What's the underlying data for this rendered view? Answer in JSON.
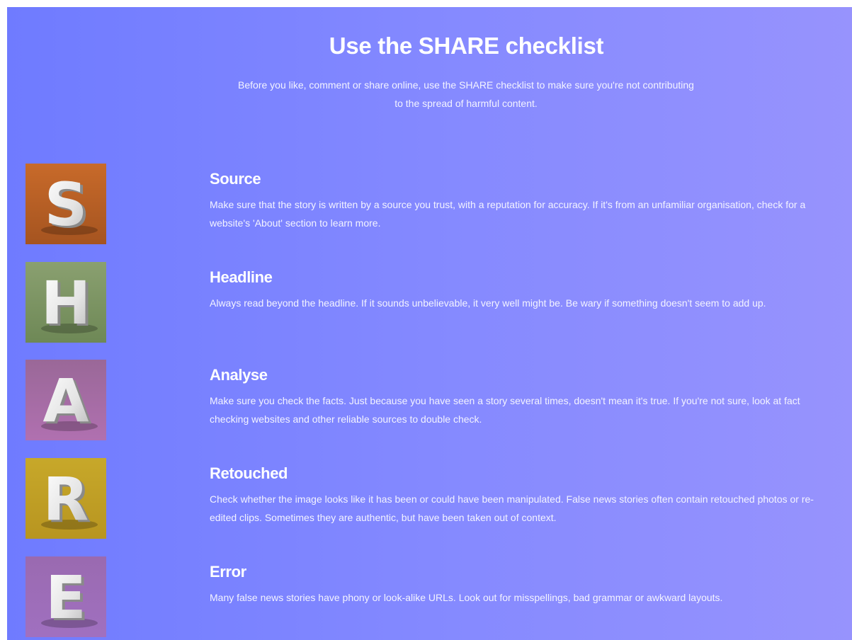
{
  "header": {
    "title": "Use the SHARE checklist",
    "intro_line1": "Before you like, comment or share online, use the SHARE checklist to make sure you're not contributing",
    "intro_line2": "to the spread of harmful content."
  },
  "colors": {
    "gradient_start": "#6f7bff",
    "gradient_end": "#9793fd",
    "text": "#ffffff"
  },
  "items": [
    {
      "letter": "S",
      "tile_color_top": "#c86a2a",
      "tile_color_bottom": "#a55420",
      "title": "Source",
      "description": "Make sure that the story is written by a source you trust, with a reputation for accuracy. If it's from an unfamiliar organisation, check for a website's 'About' section to learn more."
    },
    {
      "letter": "H",
      "tile_color_top": "#8aa070",
      "tile_color_bottom": "#6e8856",
      "title": "Headline",
      "description": "Always read beyond the headline. If it sounds unbelievable, it very well might be. Be wary if something doesn't seem to add up."
    },
    {
      "letter": "A",
      "tile_color_top": "#9a6898",
      "tile_color_bottom": "#b070b0",
      "title": "Analyse",
      "description": "Make sure you check the facts. Just because you have seen a story several times, doesn't mean it's true. If you're not sure, look at fact checking websites and other reliable sources to double check."
    },
    {
      "letter": "R",
      "tile_color_top": "#c7a82a",
      "tile_color_bottom": "#b89520",
      "title": "Retouched",
      "description": "Check whether the image looks like it has been or could have been manipulated. False news stories often contain retouched photos or re-edited clips. Sometimes they are authentic, but have been taken out of context."
    },
    {
      "letter": "E",
      "tile_color_top": "#9a6ab0",
      "tile_color_bottom": "#a070c0",
      "title": "Error",
      "description": "Many false news stories have phony or look-alike URLs. Look out for misspellings, bad grammar or awkward layouts."
    }
  ]
}
